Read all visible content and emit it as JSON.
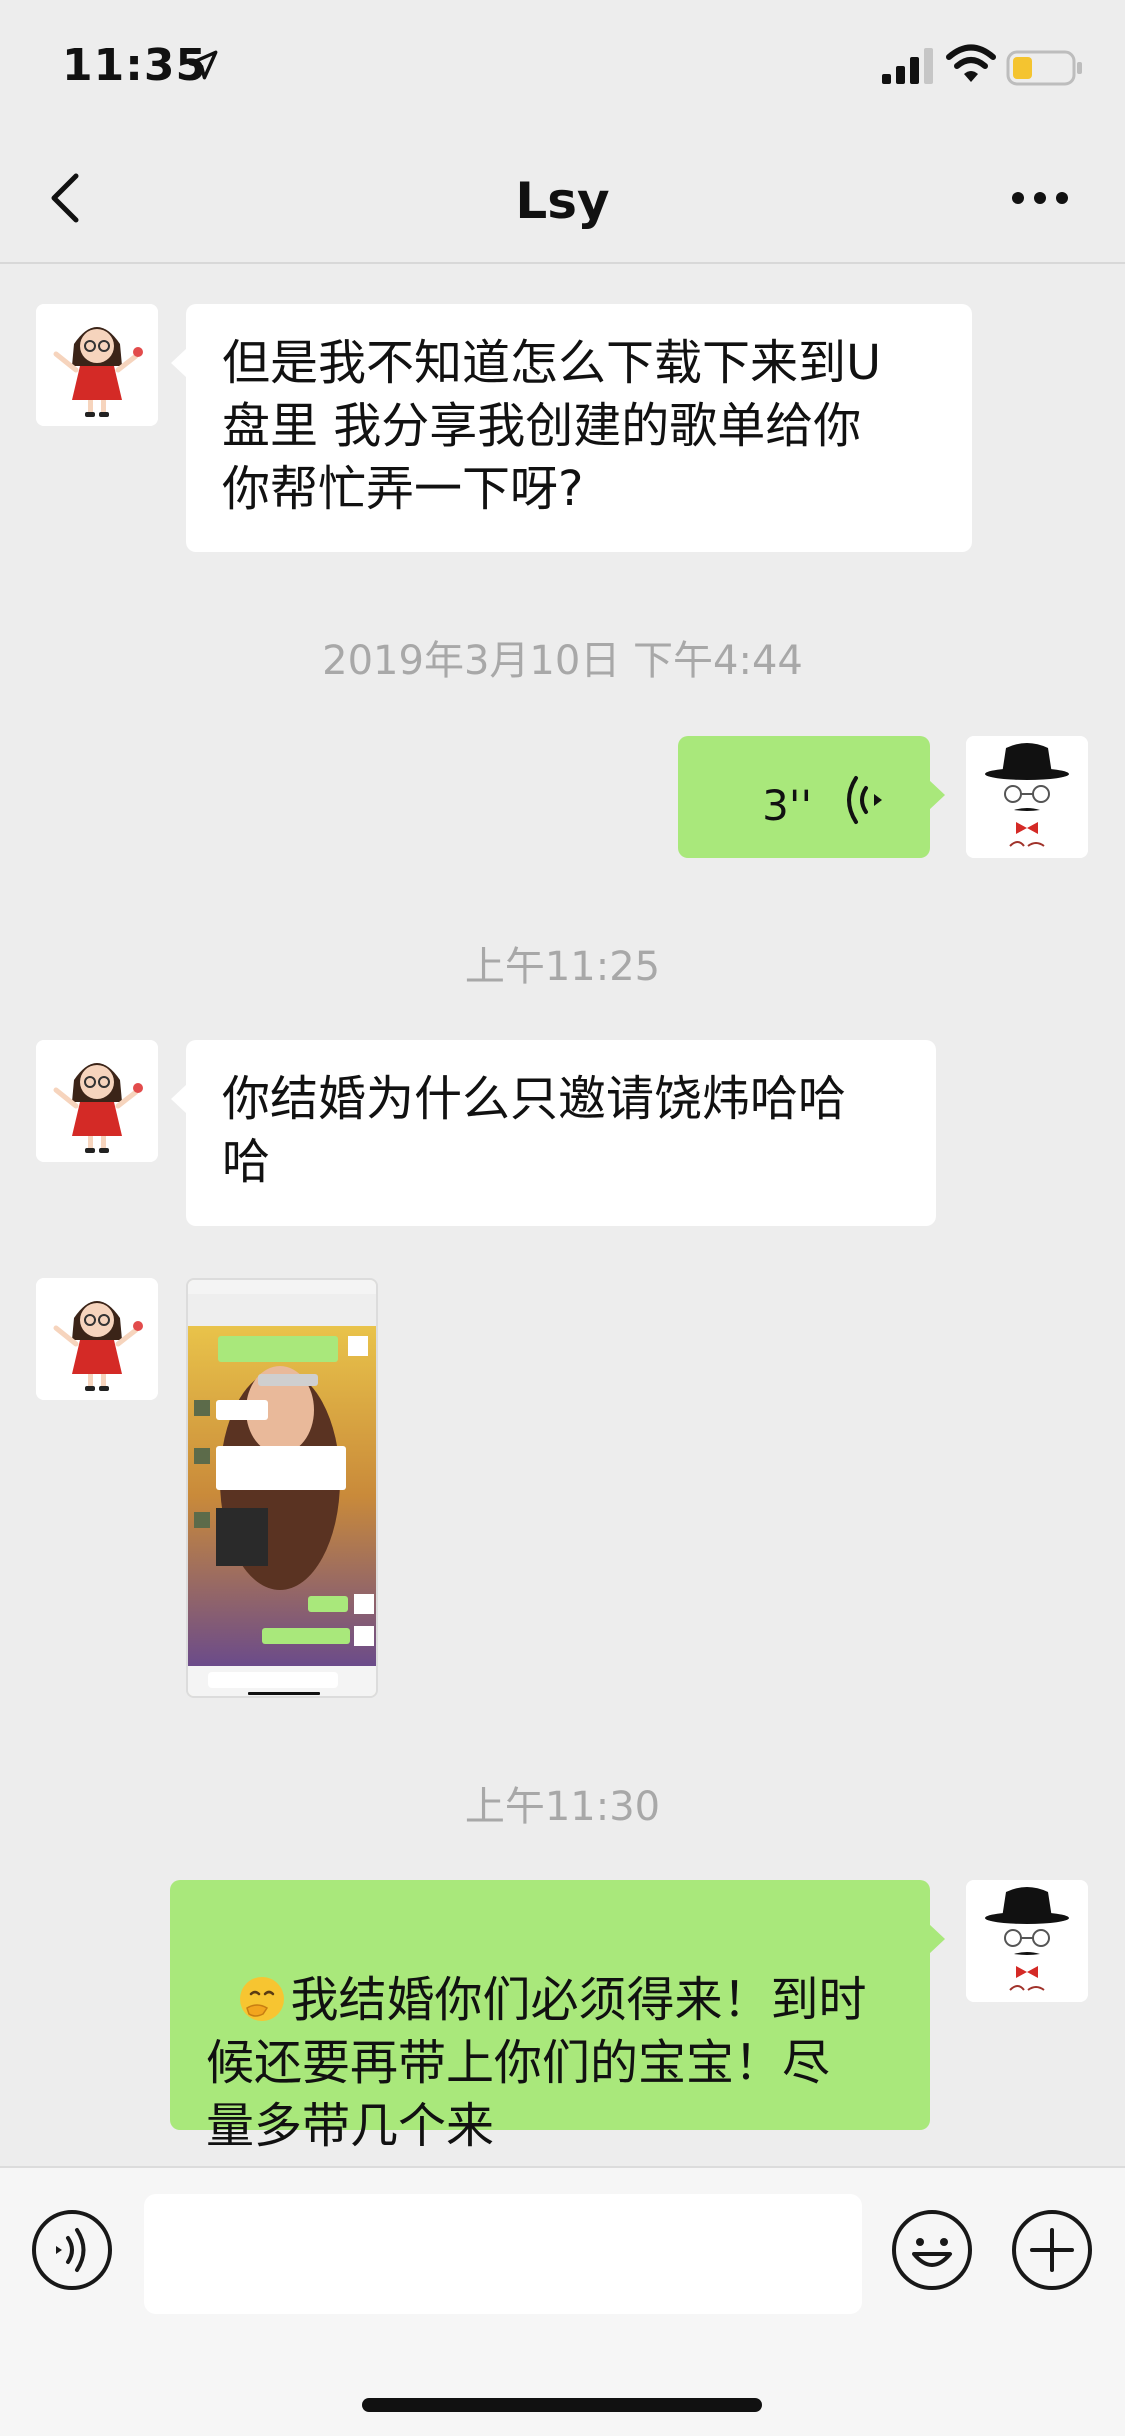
{
  "status_bar": {
    "time": "11:35",
    "icons": [
      "location-arrow-icon",
      "signal-icon",
      "wifi-icon",
      "battery-low-icon"
    ]
  },
  "nav": {
    "title": "Lsy",
    "back_icon": "chevron-left-icon",
    "more_icon": "more-dots-icon"
  },
  "messages": [
    {
      "type": "text",
      "direction": "in",
      "text": "但是我不知道怎么下载下来到U\n盘里 我分享我创建的歌单给你\n你帮忙弄一下呀?"
    },
    {
      "type": "timestamp",
      "text": "2019年3月10日 下午4:44"
    },
    {
      "type": "voice",
      "direction": "out",
      "duration": "3''"
    },
    {
      "type": "timestamp",
      "text": "上午11:25"
    },
    {
      "type": "text",
      "direction": "in",
      "text": "你结婚为什么只邀请饶炜哈哈\n哈"
    },
    {
      "type": "image",
      "direction": "in"
    },
    {
      "type": "timestamp",
      "text": "上午11:30"
    },
    {
      "type": "text",
      "direction": "out",
      "emoji": "thinking-face-emoji",
      "text": "我结婚你们必须得来！到时\n候还要再带上你们的宝宝！尽\n量多带几个来"
    }
  ],
  "input_bar": {
    "voice_icon": "voice-mode-icon",
    "emoji_icon": "emoji-icon",
    "plus_icon": "plus-icon",
    "text_value": ""
  },
  "colors": {
    "background": "#ededed",
    "outgoing_bubble": "#a9e87b",
    "incoming_bubble": "#ffffff",
    "timestamp_text": "#a8a8a8"
  }
}
